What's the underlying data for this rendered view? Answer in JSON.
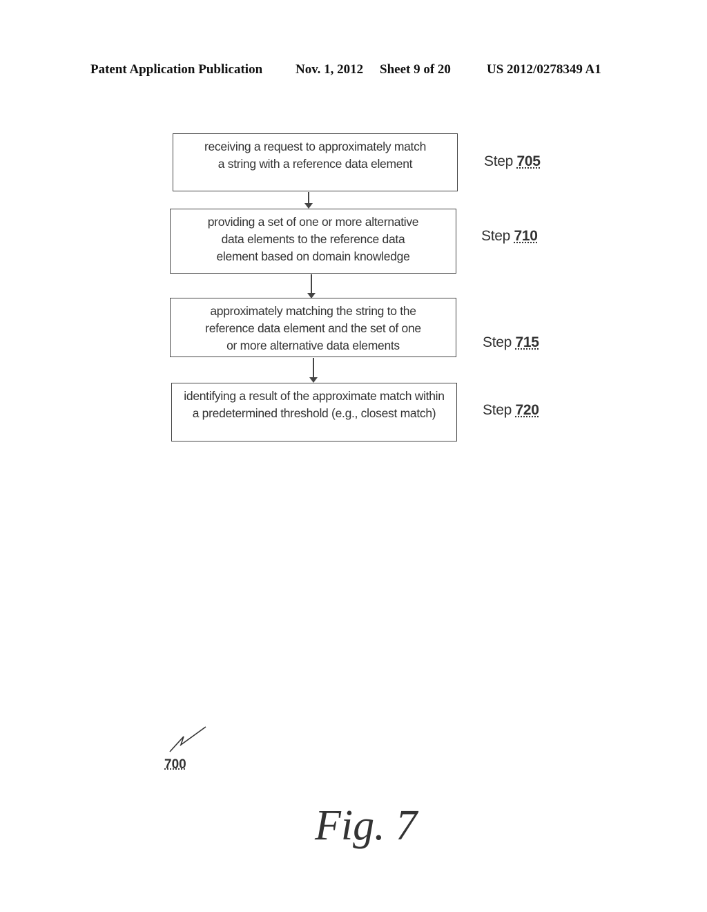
{
  "header": {
    "publication": "Patent Application Publication",
    "date": "Nov. 1, 2012",
    "sheet": "Sheet 9 of 20",
    "patent_number": "US 2012/0278349 A1"
  },
  "flowchart": {
    "steps": [
      {
        "lines": [
          "receiving a request to approximately match",
          "a string with a reference data element"
        ],
        "step_prefix": "Step",
        "step_number": "705"
      },
      {
        "lines": [
          "providing a set of one or more alternative",
          "data elements to the reference data",
          "element based on domain knowledge"
        ],
        "step_prefix": "Step",
        "step_number": "710"
      },
      {
        "lines": [
          "approximately matching the string to the",
          "reference data element and the set of one",
          "or more alternative data elements"
        ],
        "step_prefix": "Step",
        "step_number": "715"
      },
      {
        "lines": [
          "identifying a result of the approximate match within",
          "a predetermined threshold (e.g., closest match)"
        ],
        "step_prefix": "Step",
        "step_number": "720"
      }
    ]
  },
  "reference_numeral": "700",
  "figure_label": "Fig. 7"
}
